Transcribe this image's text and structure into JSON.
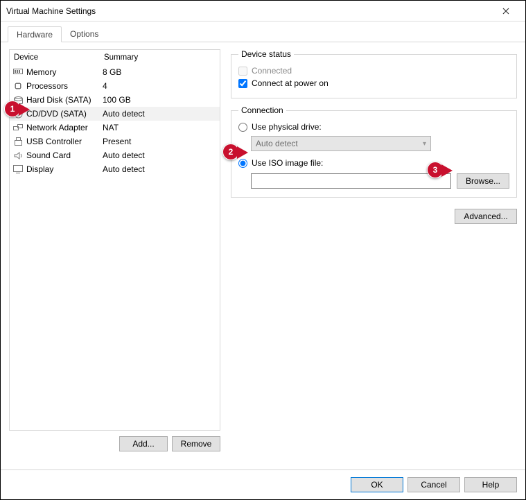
{
  "window": {
    "title": "Virtual Machine Settings"
  },
  "tabs": {
    "hardware": "Hardware",
    "options": "Options"
  },
  "headers": {
    "device": "Device",
    "summary": "Summary"
  },
  "devices": [
    {
      "name": "Memory",
      "summary": "8 GB"
    },
    {
      "name": "Processors",
      "summary": "4"
    },
    {
      "name": "Hard Disk (SATA)",
      "summary": "100 GB"
    },
    {
      "name": "CD/DVD (SATA)",
      "summary": "Auto detect"
    },
    {
      "name": "Network Adapter",
      "summary": "NAT"
    },
    {
      "name": "USB Controller",
      "summary": "Present"
    },
    {
      "name": "Sound Card",
      "summary": "Auto detect"
    },
    {
      "name": "Display",
      "summary": "Auto detect"
    }
  ],
  "left_buttons": {
    "add": "Add...",
    "remove": "Remove"
  },
  "device_status": {
    "legend": "Device status",
    "connected": "Connected",
    "connect_power_on": "Connect at power on"
  },
  "connection": {
    "legend": "Connection",
    "use_physical": "Use physical drive:",
    "physical_value": "Auto detect",
    "use_iso": "Use ISO image file:",
    "iso_value": "",
    "browse": "Browse..."
  },
  "advanced": "Advanced...",
  "footer": {
    "ok": "OK",
    "cancel": "Cancel",
    "help": "Help"
  },
  "callouts": {
    "c1": "1",
    "c2": "2",
    "c3": "3"
  }
}
